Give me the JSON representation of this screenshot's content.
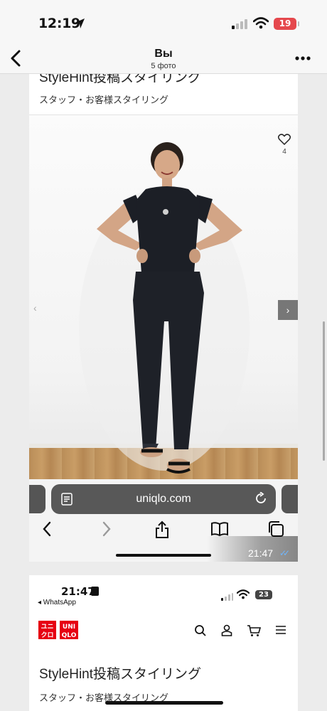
{
  "status_bar": {
    "time": "12:19",
    "battery": "19"
  },
  "nav": {
    "title": "Вы",
    "subtitle": "5 фото"
  },
  "card1": {
    "page_title": "StyleHint投稿スタイリング",
    "subtitle": "スタッフ・お客様スタイリング",
    "like_count": "4",
    "prev_arrow": "‹",
    "next_arrow": "›"
  },
  "browser": {
    "url": "uniqlo.com"
  },
  "message": {
    "time": "21:47",
    "read_ticks": "✓✓"
  },
  "card2": {
    "time": "21:47",
    "back_app": "◂ WhatsApp",
    "battery": "23",
    "logo_top": "ユニ",
    "logo_top2": "UNI",
    "logo_bot": "クロ",
    "logo_bot2": "QLO",
    "page_title": "StyleHint投稿スタイリング",
    "subtitle": "スタッフ・お客様スタイリング"
  },
  "icons": {
    "location": "location-arrow-icon",
    "signal": "cellular-signal-icon",
    "wifi": "wifi-icon",
    "battery": "battery-icon",
    "back": "chevron-left-icon",
    "more": "more-dots-icon",
    "heart": "heart-icon",
    "reader": "reader-mode-icon",
    "reload": "reload-icon",
    "share": "share-icon",
    "bookmarks": "bookmarks-icon",
    "tabs": "tabs-icon",
    "search": "search-icon",
    "account": "account-icon",
    "cart": "cart-icon",
    "menu": "hamburger-menu-icon"
  },
  "colors": {
    "battery_low": "#e5484d",
    "uniqlo_red": "#e60012",
    "tick_blue": "#6fb6ff"
  }
}
